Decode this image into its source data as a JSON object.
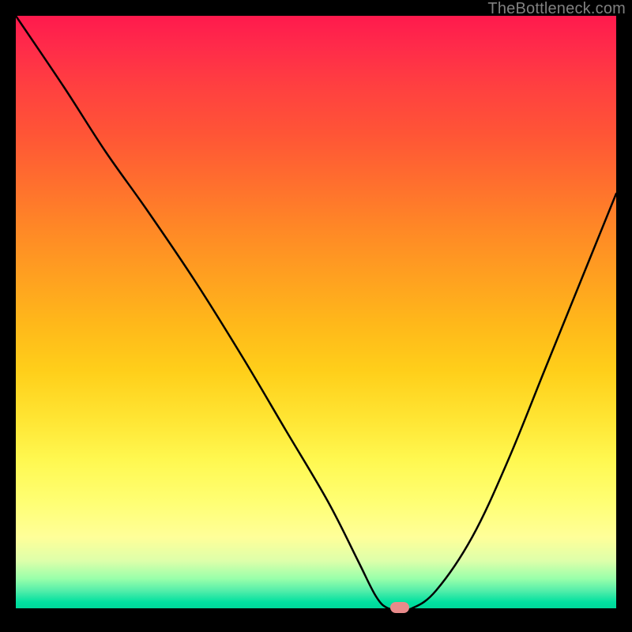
{
  "watermark": "TheBottleneck.com",
  "chart_data": {
    "type": "line",
    "title": "",
    "xlabel": "",
    "ylabel": "",
    "xlim": [
      0,
      100
    ],
    "ylim": [
      0,
      100
    ],
    "x": [
      0,
      8,
      15,
      22,
      30,
      38,
      45,
      52,
      57,
      60,
      62,
      64,
      66,
      70,
      76,
      82,
      88,
      94,
      100
    ],
    "y": [
      100,
      88,
      77,
      67,
      55,
      42,
      30,
      18,
      8,
      2,
      0,
      0,
      0,
      3,
      12,
      25,
      40,
      55,
      70
    ],
    "marker_position": {
      "x": 64,
      "y": 0
    },
    "background_gradient": {
      "type": "vertical",
      "stops": [
        {
          "pos": 0.0,
          "color": "#ff1a4d"
        },
        {
          "pos": 0.5,
          "color": "#ffb81a"
        },
        {
          "pos": 0.82,
          "color": "#ffff73"
        },
        {
          "pos": 1.0,
          "color": "#00d89a"
        }
      ]
    },
    "line_color": "#000000",
    "marker_color": "#e88a8a"
  }
}
